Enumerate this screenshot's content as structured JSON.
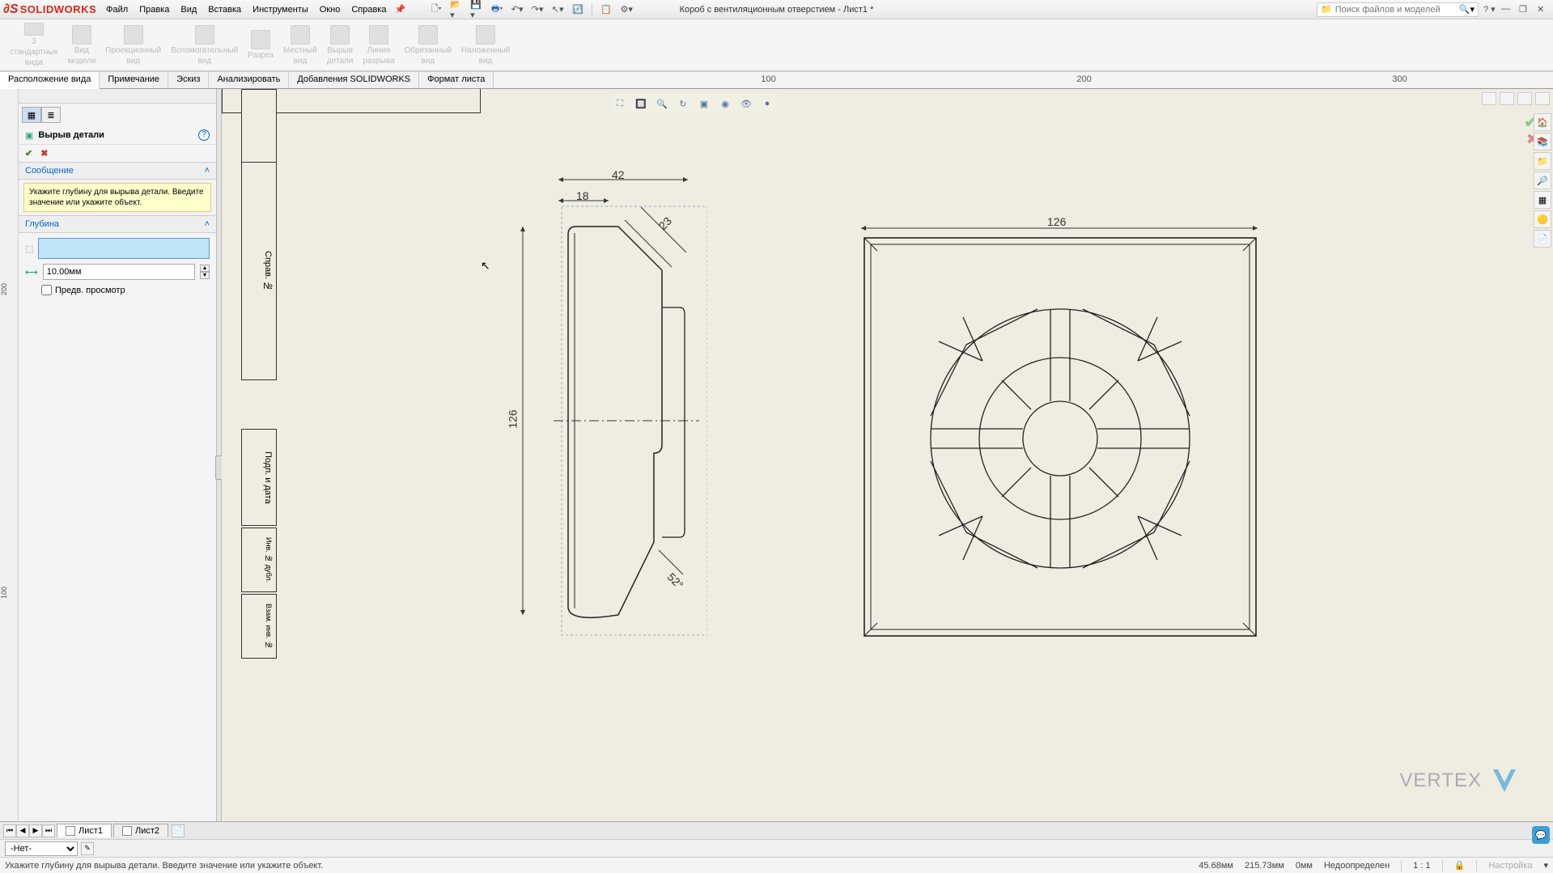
{
  "app": {
    "logo": "SOLIDWORKS"
  },
  "menu": {
    "items": [
      "Файл",
      "Правка",
      "Вид",
      "Вставка",
      "Инструменты",
      "Окно",
      "Справка"
    ]
  },
  "doc": {
    "title": "Короб с вентиляционным отверстием - Лист1 *"
  },
  "search": {
    "placeholder": "Поиск файлов и моделей"
  },
  "ribbon": {
    "buttons": [
      {
        "l1": "3",
        "l2": "стандартных",
        "l3": "вида"
      },
      {
        "l1": "Вид",
        "l2": "модели"
      },
      {
        "l1": "Проекционный",
        "l2": "вид"
      },
      {
        "l1": "Вспомогательный",
        "l2": "вид"
      },
      {
        "l1": "Разрез"
      },
      {
        "l1": "Местный",
        "l2": "вид"
      },
      {
        "l1": "Вырыв",
        "l2": "детали"
      },
      {
        "l1": "Линия",
        "l2": "разрыва"
      },
      {
        "l1": "Обрезанный",
        "l2": "вид"
      },
      {
        "l1": "Наложенный",
        "l2": "вид"
      }
    ]
  },
  "cmd_tabs": {
    "items": [
      "Расположение вида",
      "Примечание",
      "Эскиз",
      "Анализировать",
      "Добавления SOLIDWORKS",
      "Формат листа"
    ],
    "active": 0
  },
  "ruler": {
    "marks": [
      "100",
      "200",
      "300"
    ]
  },
  "panel": {
    "title": "Вырыв детали",
    "msg_head": "Сообщение",
    "msg": "Укажите глубину для вырыва детали. Введите значение или укажите объект.",
    "depth_head": "Глубина",
    "depth_value": "10.00мм",
    "preview": "Предв. просмотр"
  },
  "sheet_tabs": {
    "items": [
      "Лист1",
      "Лист2"
    ],
    "active": 0
  },
  "layer": {
    "value": "-Нет-"
  },
  "status": {
    "prompt": "Укажите глубину для вырыва детали. Введите значение или укажите объект.",
    "x": "45.68мм",
    "y": "215.73мм",
    "z": "0мм",
    "state": "Недоопределен",
    "scale": "1 : 1",
    "settings": "Настройка"
  },
  "dims": {
    "d42": "42",
    "d18": "18",
    "d23": "23",
    "d126a": "126",
    "d126b": "126",
    "d52": "52°"
  },
  "watermark": {
    "text": "VERTEX"
  }
}
